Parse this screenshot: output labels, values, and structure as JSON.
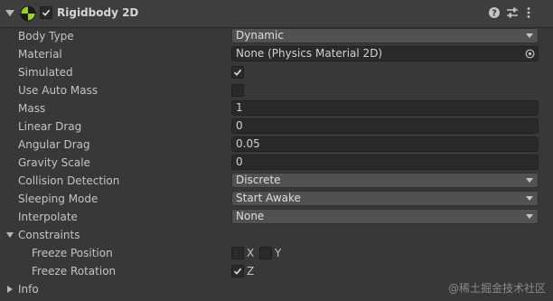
{
  "component": {
    "title": "Rigidbody 2D",
    "enabled": true,
    "icons": [
      "rigidbody-icon",
      "help-icon",
      "preset-icon",
      "menu-icon"
    ]
  },
  "properties": {
    "body_type": {
      "label": "Body Type",
      "value": "Dynamic"
    },
    "material": {
      "label": "Material",
      "value": "None (Physics Material 2D)"
    },
    "simulated": {
      "label": "Simulated",
      "checked": true
    },
    "use_auto_mass": {
      "label": "Use Auto Mass",
      "checked": false
    },
    "mass": {
      "label": "Mass",
      "value": "1"
    },
    "linear_drag": {
      "label": "Linear Drag",
      "value": "0"
    },
    "angular_drag": {
      "label": "Angular Drag",
      "value": "0.05"
    },
    "gravity_scale": {
      "label": "Gravity Scale",
      "value": "0"
    },
    "collision_detection": {
      "label": "Collision Detection",
      "value": "Discrete"
    },
    "sleeping_mode": {
      "label": "Sleeping Mode",
      "value": "Start Awake"
    },
    "interpolate": {
      "label": "Interpolate",
      "value": "None"
    }
  },
  "constraints": {
    "label": "Constraints",
    "expanded": true,
    "freeze_position": {
      "label": "Freeze Position",
      "x_label": "X",
      "y_label": "Y",
      "x": false,
      "y": false
    },
    "freeze_rotation": {
      "label": "Freeze Rotation",
      "z_label": "Z",
      "z": true
    }
  },
  "info": {
    "label": "Info",
    "expanded": false
  },
  "watermark": "@稀土掘金技术社区",
  "colors": {
    "background": "#383838",
    "field": "#2a2a2a",
    "dropdown": "#515151",
    "text": "#c4c4c4"
  }
}
